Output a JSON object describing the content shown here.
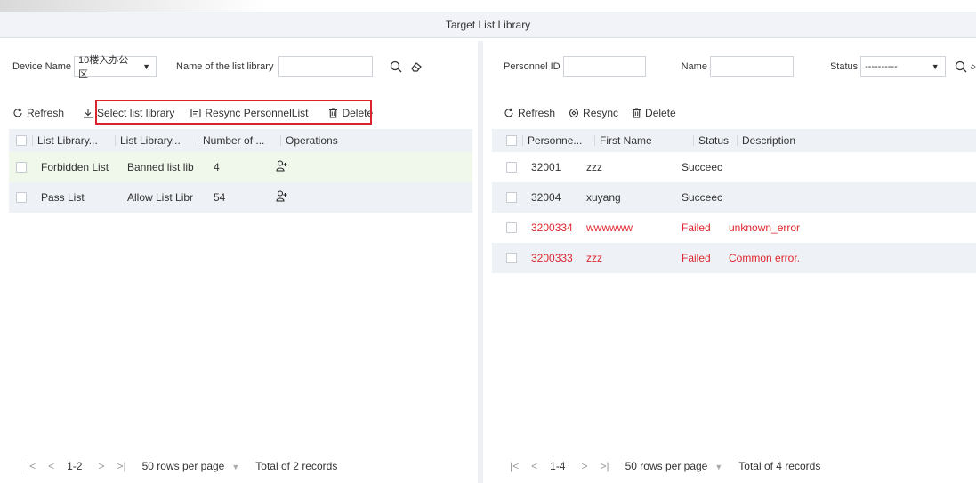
{
  "window": {
    "title": "Target List Library"
  },
  "left": {
    "filters": {
      "device_label": "Device Name",
      "device_value": "10楼入办公区",
      "list_name_label": "Name of the list library",
      "list_name_value": ""
    },
    "toolbar": {
      "refresh": "Refresh",
      "select_list": "Select list library",
      "resync": "Resync PersonnelList",
      "delete": "Delete"
    },
    "table": {
      "headers": [
        "List Library...",
        "List Library...",
        "Number of ...",
        "Operations"
      ],
      "rows": [
        {
          "name": "Forbidden List",
          "type": "Banned list lib",
          "count": "4",
          "op_icon": "add-person-icon"
        },
        {
          "name": "Pass List",
          "type": "Allow List Libr",
          "count": "54",
          "op_icon": "add-person-icon"
        }
      ]
    },
    "pager": {
      "first": "|<",
      "prev": "<",
      "range": "1-2",
      "next": ">",
      "last": ">|",
      "rows_per_page": "50 rows per page",
      "total": "Total of 2 records"
    }
  },
  "right": {
    "filters": {
      "personnel_id_label": "Personnel ID",
      "name_label": "Name",
      "status_label": "Status",
      "status_value": "----------"
    },
    "toolbar": {
      "refresh": "Refresh",
      "resync": "Resync",
      "delete": "Delete"
    },
    "table": {
      "headers": [
        "Personne...",
        "First Name",
        "Status",
        "Description"
      ],
      "rows": [
        {
          "id": "32001",
          "first_name": "zzz",
          "status": "Succeec",
          "description": "",
          "error": false
        },
        {
          "id": "32004",
          "first_name": "xuyang",
          "status": "Succeec",
          "description": "",
          "error": false
        },
        {
          "id": "3200334",
          "first_name": "wwwwww",
          "status": "Failed",
          "description": "unknown_error",
          "error": true
        },
        {
          "id": "3200333",
          "first_name": "zzz",
          "status": "Failed",
          "description": "Common error.",
          "error": true
        }
      ]
    },
    "pager": {
      "first": "|<",
      "prev": "<",
      "range": "1-4",
      "next": ">",
      "last": ">|",
      "rows_per_page": "50 rows per page",
      "total": "Total of 4 records"
    }
  },
  "colors": {
    "error": "#e0262e",
    "highlight": "#d9232d",
    "row_alt": "#eef1f6",
    "row_selected": "#f0f8ec"
  }
}
